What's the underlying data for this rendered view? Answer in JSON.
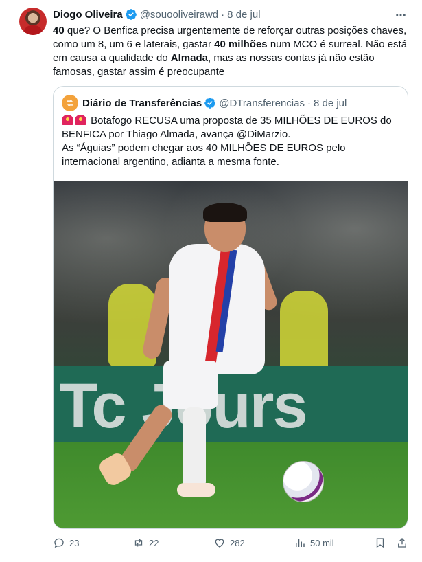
{
  "tweet": {
    "author_name": "Diogo Oliveira",
    "handle": "@souooliveirawd",
    "separator": "·",
    "date": "8 de jul",
    "text_parts": {
      "p1_bold": "40",
      "p2": " que? O Benfica precisa urgentemente de reforçar outras posições chaves, como um 8, um 6 e laterais, gastar ",
      "p3_bold": "40 milhões",
      "p4": " num MCO é surreal. Não está em causa a qualidade do ",
      "p5_bold": "Almada",
      "p6": ", mas as nossas contas já não estão famosas, gastar assim é preocupante"
    }
  },
  "quote": {
    "author_name": "Diário de Transferências",
    "handle": "@DTransferencias",
    "separator": "·",
    "date": "8 de jul",
    "line1": " Botafogo RECUSA uma proposta de 35 MILHÕES DE EUROS do BENFICA por Thiago Almada, avança @DiMarzio.",
    "line2": "As “Águias” podem chegar aos 40 MILHÕES DE EUROS pelo internacional argentino, adianta a mesma fonte.",
    "board_text": "Tc Jours"
  },
  "actions": {
    "replies": "23",
    "reposts": "22",
    "likes": "282",
    "views": "50 mil"
  },
  "colors": {
    "verified": "#1d9bf0",
    "muted": "#536471",
    "border": "#cfd9de",
    "avatar_quote": "#f3a23b"
  },
  "icons": {
    "more": "more-icon",
    "reply": "reply-icon",
    "repost": "repost-icon",
    "like": "like-icon",
    "views": "views-icon",
    "bookmark": "bookmark-icon",
    "share": "share-icon"
  }
}
